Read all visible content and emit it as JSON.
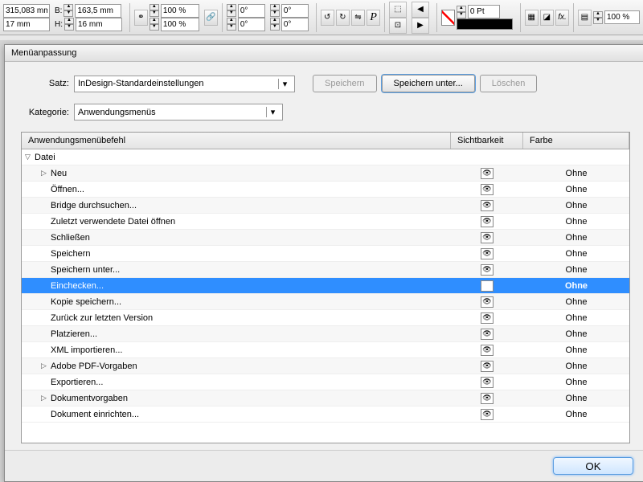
{
  "toolbar": {
    "x_value": "315,083 mm",
    "y_value": "17 mm",
    "w_label": "B:",
    "w_value": "163,5 mm",
    "h_label": "H:",
    "h_value": "16 mm",
    "scale_x": "100 %",
    "scale_y": "100 %",
    "rot1": "0°",
    "rot2": "0°",
    "shear1": "0°",
    "shear2": "0°",
    "stroke_w": "0 Pt",
    "opacity": "100 %"
  },
  "dialog": {
    "title": "Menüanpassung",
    "satz_label": "Satz:",
    "satz_value": "InDesign-Standardeinstellungen",
    "save_label": "Speichern",
    "saveas_label": "Speichern unter...",
    "delete_label": "Löschen",
    "kategorie_label": "Kategorie:",
    "kategorie_value": "Anwendungsmenüs",
    "col_cmd": "Anwendungsmenübefehl",
    "col_vis": "Sichtbarkeit",
    "col_color": "Farbe",
    "ok_label": "OK",
    "rows": [
      {
        "label": "Datei",
        "indent": 0,
        "disclosure": "▽",
        "selected": false,
        "eye": false,
        "color": ""
      },
      {
        "label": "Neu",
        "indent": 1,
        "disclosure": "▷",
        "selected": false,
        "eye": true,
        "color": "Ohne"
      },
      {
        "label": "Öffnen...",
        "indent": 1,
        "disclosure": "",
        "selected": false,
        "eye": true,
        "color": "Ohne"
      },
      {
        "label": "Bridge durchsuchen...",
        "indent": 1,
        "disclosure": "",
        "selected": false,
        "eye": true,
        "color": "Ohne"
      },
      {
        "label": "Zuletzt verwendete Datei öffnen",
        "indent": 1,
        "disclosure": "",
        "selected": false,
        "eye": true,
        "color": "Ohne"
      },
      {
        "label": "Schließen",
        "indent": 1,
        "disclosure": "",
        "selected": false,
        "eye": true,
        "color": "Ohne"
      },
      {
        "label": "Speichern",
        "indent": 1,
        "disclosure": "",
        "selected": false,
        "eye": true,
        "color": "Ohne"
      },
      {
        "label": "Speichern unter...",
        "indent": 1,
        "disclosure": "",
        "selected": false,
        "eye": true,
        "color": "Ohne"
      },
      {
        "label": "Einchecken...",
        "indent": 1,
        "disclosure": "",
        "selected": true,
        "eye": true,
        "color": "Ohne"
      },
      {
        "label": "Kopie speichern...",
        "indent": 1,
        "disclosure": "",
        "selected": false,
        "eye": true,
        "color": "Ohne"
      },
      {
        "label": "Zurück zur letzten Version",
        "indent": 1,
        "disclosure": "",
        "selected": false,
        "eye": true,
        "color": "Ohne"
      },
      {
        "label": "Platzieren...",
        "indent": 1,
        "disclosure": "",
        "selected": false,
        "eye": true,
        "color": "Ohne"
      },
      {
        "label": "XML importieren...",
        "indent": 1,
        "disclosure": "",
        "selected": false,
        "eye": true,
        "color": "Ohne"
      },
      {
        "label": "Adobe PDF-Vorgaben",
        "indent": 1,
        "disclosure": "▷",
        "selected": false,
        "eye": true,
        "color": "Ohne"
      },
      {
        "label": "Exportieren...",
        "indent": 1,
        "disclosure": "",
        "selected": false,
        "eye": true,
        "color": "Ohne"
      },
      {
        "label": "Dokumentvorgaben",
        "indent": 1,
        "disclosure": "▷",
        "selected": false,
        "eye": true,
        "color": "Ohne"
      },
      {
        "label": "Dokument einrichten...",
        "indent": 1,
        "disclosure": "",
        "selected": false,
        "eye": true,
        "color": "Ohne"
      }
    ]
  }
}
